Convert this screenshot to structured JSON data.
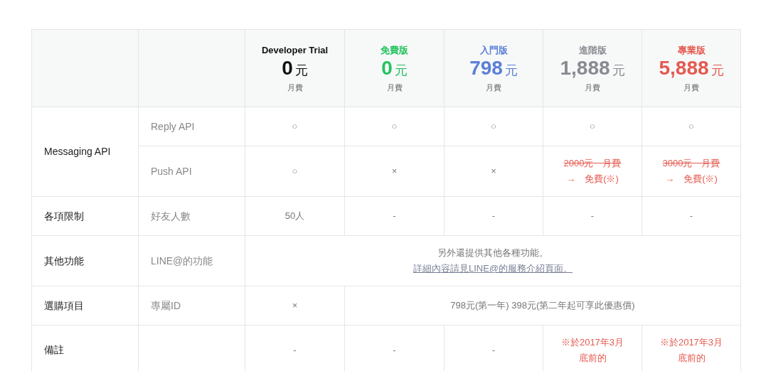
{
  "plans": [
    {
      "name": "Developer Trial",
      "price": "0",
      "unit": "元",
      "period": "月費",
      "color": "#111111"
    },
    {
      "name": "免費版",
      "price": "0",
      "unit": "元",
      "period": "月費",
      "color": "#22c35e"
    },
    {
      "name": "入門版",
      "price": "798",
      "unit": "元",
      "period": "月費",
      "color": "#5b80d8"
    },
    {
      "name": "進階版",
      "price": "1,888",
      "unit": "元",
      "period": "月費",
      "color": "#888b91"
    },
    {
      "name": "專業版",
      "price": "5,888",
      "unit": "元",
      "period": "月費",
      "color": "#e55a50"
    }
  ],
  "sections": [
    {
      "label": "Messaging API",
      "rows": [
        {
          "label": "Reply API",
          "cells": [
            {
              "highlighted": false,
              "lines": [
                {
                  "kind": "plain",
                  "text": "○"
                }
              ]
            },
            {
              "highlighted": false,
              "lines": [
                {
                  "kind": "plain",
                  "text": "○"
                }
              ]
            },
            {
              "highlighted": false,
              "lines": [
                {
                  "kind": "plain",
                  "text": "○"
                }
              ]
            },
            {
              "highlighted": false,
              "lines": [
                {
                  "kind": "plain",
                  "text": "○"
                }
              ]
            },
            {
              "highlighted": false,
              "lines": [
                {
                  "kind": "plain",
                  "text": "○"
                }
              ]
            }
          ]
        },
        {
          "label": "Push API",
          "cells": [
            {
              "highlighted": false,
              "lines": [
                {
                  "kind": "plain",
                  "text": "○"
                }
              ]
            },
            {
              "highlighted": false,
              "lines": [
                {
                  "kind": "plain",
                  "text": "×"
                }
              ]
            },
            {
              "highlighted": false,
              "lines": [
                {
                  "kind": "plain",
                  "text": "×"
                }
              ]
            },
            {
              "highlighted": true,
              "lines": [
                {
                  "kind": "struck",
                  "text": "2000元　月費"
                },
                {
                  "kind": "plain",
                  "text": "→　免費(※)"
                }
              ]
            },
            {
              "highlighted": true,
              "lines": [
                {
                  "kind": "struck",
                  "text": "3000元　月費"
                },
                {
                  "kind": "plain",
                  "text": "→　免費(※)"
                }
              ]
            }
          ]
        }
      ]
    },
    {
      "label": "各項限制",
      "rows": [
        {
          "label": "好友人數",
          "cells": [
            {
              "highlighted": false,
              "lines": [
                {
                  "kind": "plain",
                  "text": "50人"
                }
              ]
            },
            {
              "highlighted": false,
              "lines": [
                {
                  "kind": "plain",
                  "text": "-"
                }
              ]
            },
            {
              "highlighted": false,
              "lines": [
                {
                  "kind": "plain",
                  "text": "-"
                }
              ]
            },
            {
              "highlighted": false,
              "lines": [
                {
                  "kind": "plain",
                  "text": "-"
                }
              ]
            },
            {
              "highlighted": false,
              "lines": [
                {
                  "kind": "plain",
                  "text": "-"
                }
              ]
            }
          ]
        }
      ]
    },
    {
      "label": "其他功能",
      "rows": [
        {
          "label": "LINE@的功能",
          "cells": [
            {
              "highlighted": false,
              "lines": [
                {
                  "kind": "plain",
                  "text": "另外還提供其他各種功能。"
                },
                {
                  "kind": "link",
                  "text": "詳細內容請見LINE@的服務介紹頁面。"
                }
              ]
            }
          ]
        }
      ]
    },
    {
      "label": "選購項目",
      "rows": [
        {
          "label": "專屬ID",
          "cells": [
            {
              "highlighted": false,
              "lines": [
                {
                  "kind": "plain",
                  "text": "×"
                }
              ]
            },
            {
              "highlighted": false,
              "lines": [
                {
                  "kind": "plain",
                  "text": "798元(第一年) 398元(第二年起可享此優惠價)"
                }
              ]
            }
          ]
        }
      ]
    },
    {
      "label": "備註",
      "rows": [
        {
          "cells": [
            {
              "highlighted": false,
              "lines": [
                {
                  "kind": "plain",
                  "text": "-"
                }
              ]
            },
            {
              "highlighted": false,
              "lines": [
                {
                  "kind": "plain",
                  "text": "-"
                }
              ]
            },
            {
              "highlighted": false,
              "lines": [
                {
                  "kind": "plain",
                  "text": "-"
                }
              ]
            },
            {
              "highlighted": true,
              "lines": [
                {
                  "kind": "plain",
                  "text": "※於2017年3月"
                },
                {
                  "kind": "plain",
                  "text": "底前的"
                }
              ]
            },
            {
              "highlighted": true,
              "lines": [
                {
                  "kind": "plain",
                  "text": "※於2017年3月"
                },
                {
                  "kind": "plain",
                  "text": "底前的"
                }
              ]
            }
          ]
        }
      ]
    }
  ]
}
